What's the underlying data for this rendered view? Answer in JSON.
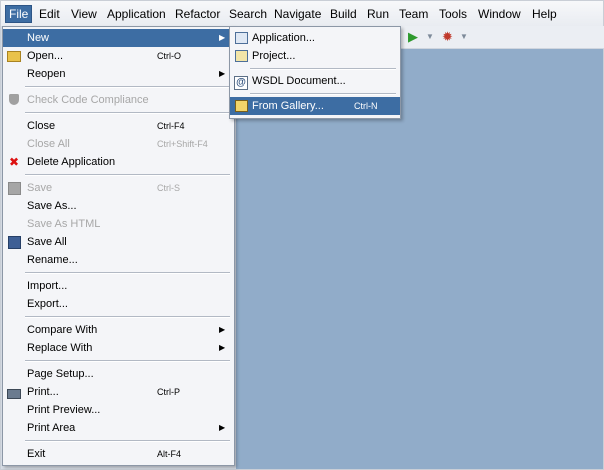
{
  "menubar": {
    "items": [
      {
        "label": "File",
        "active": true
      },
      {
        "label": "Edit"
      },
      {
        "label": "View"
      },
      {
        "label": "Application"
      },
      {
        "label": "Refactor"
      },
      {
        "label": "Search"
      },
      {
        "label": "Navigate"
      },
      {
        "label": "Build"
      },
      {
        "label": "Run"
      },
      {
        "label": "Team"
      },
      {
        "label": "Tools"
      },
      {
        "label": "Window"
      },
      {
        "label": "Help"
      }
    ]
  },
  "toolbar": {
    "run_icon": "play-icon",
    "debug_icon": "bug-icon"
  },
  "file_menu": {
    "new": "New",
    "open": "Open...",
    "open_shortcut": "Ctrl-O",
    "reopen": "Reopen",
    "check_code": "Check Code Compliance",
    "close": "Close",
    "close_shortcut": "Ctrl-F4",
    "close_all": "Close All",
    "close_all_shortcut": "Ctrl+Shift-F4",
    "delete_app": "Delete Application",
    "save": "Save",
    "save_shortcut": "Ctrl-S",
    "save_as": "Save As...",
    "save_as_html": "Save As HTML",
    "save_all": "Save All",
    "rename": "Rename...",
    "import": "Import...",
    "export": "Export...",
    "compare_with": "Compare With",
    "replace_with": "Replace With",
    "page_setup": "Page Setup...",
    "print": "Print...",
    "print_shortcut": "Ctrl-P",
    "print_preview": "Print Preview...",
    "print_area": "Print Area",
    "exit": "Exit",
    "exit_shortcut": "Alt-F4"
  },
  "new_submenu": {
    "application": "Application...",
    "project": "Project...",
    "wsdl": "WSDL Document...",
    "from_gallery": "From Gallery...",
    "from_gallery_shortcut": "Ctrl-N"
  },
  "colors": {
    "selection": "#3d6da3",
    "workspace": "#91acc9"
  }
}
